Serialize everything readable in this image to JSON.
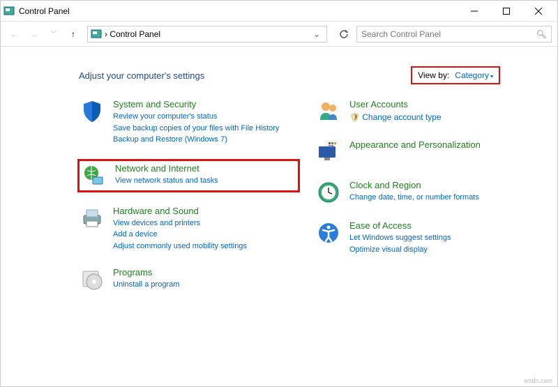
{
  "window": {
    "title": "Control Panel"
  },
  "address": {
    "path": "› Control Panel"
  },
  "search": {
    "placeholder": "Search Control Panel"
  },
  "header": {
    "title": "Adjust your computer's settings"
  },
  "viewby": {
    "label": "View by:",
    "value": "Category"
  },
  "left": [
    {
      "title": "System and Security",
      "links": [
        "Review your computer's status",
        "Save backup copies of your files with File History",
        "Backup and Restore (Windows 7)"
      ]
    },
    {
      "title": "Network and Internet",
      "links": [
        "View network status and tasks"
      ]
    },
    {
      "title": "Hardware and Sound",
      "links": [
        "View devices and printers",
        "Add a device",
        "Adjust commonly used mobility settings"
      ]
    },
    {
      "title": "Programs",
      "links": [
        "Uninstall a program"
      ]
    }
  ],
  "right": [
    {
      "title": "User Accounts",
      "links": [
        "Change account type"
      ]
    },
    {
      "title": "Appearance and Personalization",
      "links": []
    },
    {
      "title": "Clock and Region",
      "links": [
        "Change date, time, or number formats"
      ]
    },
    {
      "title": "Ease of Access",
      "links": [
        "Let Windows suggest settings",
        "Optimize visual display"
      ]
    }
  ],
  "watermark": "wsdn.com"
}
